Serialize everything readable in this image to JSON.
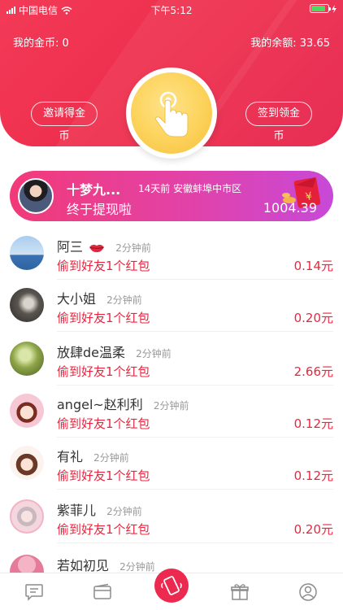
{
  "status_bar": {
    "carrier": "中国电信",
    "time": "下午5:12"
  },
  "header": {
    "coins_label": "我的金币: 0",
    "balance_label": "我的余额: 33.65",
    "invite_button": "邀请得金币",
    "signin_button": "签到领金币",
    "colors": {
      "primary": "#ee2f4d",
      "coin": "#fcd25a"
    }
  },
  "banner": {
    "name": "十梦九...",
    "time_location": "14天前 安徽蚌埠中市区",
    "message": "终于提现啦",
    "amount": "1004.39"
  },
  "feed": [
    {
      "name": "阿三",
      "time": "2分钟前",
      "message": "偷到好友1个红包",
      "amount": "0.14元",
      "has_badge": true
    },
    {
      "name": "大小姐",
      "time": "2分钟前",
      "message": "偷到好友1个红包",
      "amount": "0.20元"
    },
    {
      "name": "放肆de温柔",
      "time": "2分钟前",
      "message": "偷到好友1个红包",
      "amount": "2.66元"
    },
    {
      "name": "angel~赵利利",
      "time": "2分钟前",
      "message": "偷到好友1个红包",
      "amount": "0.12元"
    },
    {
      "name": "有礼",
      "time": "2分钟前",
      "message": "偷到好友1个红包",
      "amount": "0.12元"
    },
    {
      "name": "紫菲儿",
      "time": "2分钟前",
      "message": "偷到好友1个红包",
      "amount": "0.20元"
    },
    {
      "name": "若如初见",
      "time": "2分钟前"
    }
  ],
  "tabbar": {
    "icons": [
      "message-icon",
      "wallet-icon",
      "phone-shake-icon",
      "gift-icon",
      "profile-icon"
    ]
  }
}
